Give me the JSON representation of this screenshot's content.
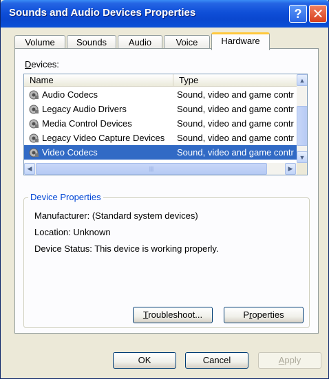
{
  "window": {
    "title": "Sounds and Audio Devices Properties",
    "help_glyph": "?",
    "close_glyph": "✕"
  },
  "tabs": [
    {
      "label": "Volume"
    },
    {
      "label": "Sounds"
    },
    {
      "label": "Audio"
    },
    {
      "label": "Voice"
    },
    {
      "label": "Hardware",
      "active": true
    }
  ],
  "devices": {
    "label_prefix": "D",
    "label_rest": "evices:",
    "columns": {
      "name": "Name",
      "type": "Type"
    },
    "rows": [
      {
        "name": "Audio Codecs",
        "type": "Sound, video and game contr"
      },
      {
        "name": "Legacy Audio Drivers",
        "type": "Sound, video and game contr"
      },
      {
        "name": "Media Control Devices",
        "type": "Sound, video and game contr"
      },
      {
        "name": "Legacy Video Capture Devices",
        "type": "Sound, video and game contr"
      },
      {
        "name": "Video Codecs",
        "type": "Sound, video and game contr",
        "selected": true
      }
    ]
  },
  "device_properties": {
    "title": "Device Properties",
    "manufacturer": "Manufacturer: (Standard system devices)",
    "location": "Location: Unknown",
    "status": "Device Status: This device is working properly."
  },
  "panel_buttons": {
    "troubleshoot_accel": "T",
    "troubleshoot_rest": "roubleshoot...",
    "properties_pre": "P",
    "properties_accel": "r",
    "properties_rest": "operties"
  },
  "footer_buttons": {
    "ok": "OK",
    "cancel": "Cancel",
    "apply_accel": "A",
    "apply_rest": "pply"
  },
  "colors": {
    "title_bar": "#0A47CF",
    "selection": "#316AC5",
    "group_title": "#0046D5",
    "active_tab_accent": "#FFC83C"
  }
}
